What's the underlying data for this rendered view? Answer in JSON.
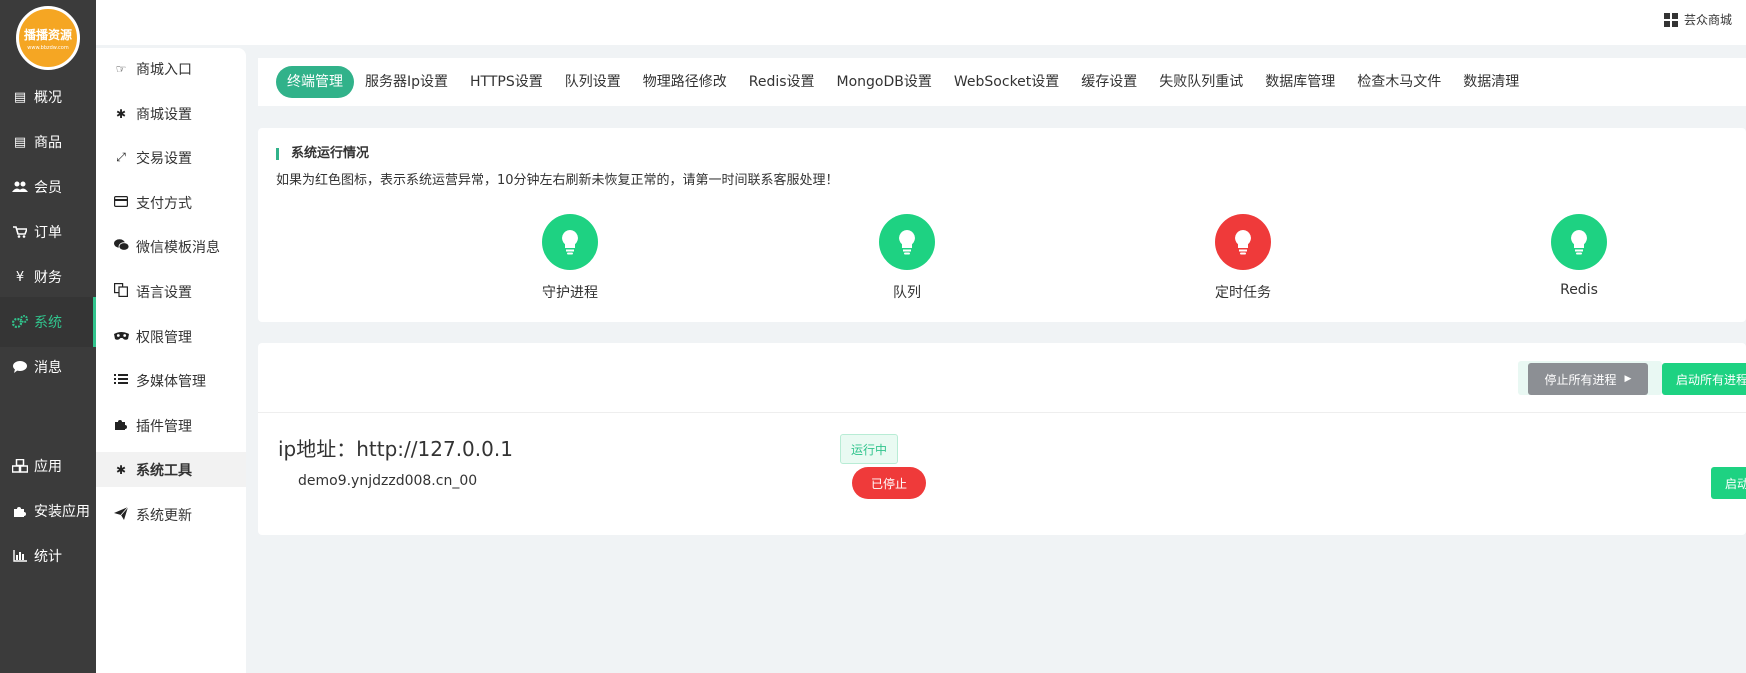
{
  "brand": {
    "logo_text": "播播资源",
    "logo_sub": "www.bbzdw.com"
  },
  "main_nav": [
    {
      "label": "概况",
      "icon": "dashboard-icon"
    },
    {
      "label": "商品",
      "icon": "product-icon"
    },
    {
      "label": "会员",
      "icon": "users-icon"
    },
    {
      "label": "订单",
      "icon": "cart-icon"
    },
    {
      "label": "财务",
      "icon": "yen-icon"
    },
    {
      "label": "系统",
      "icon": "gears-icon",
      "active": true
    },
    {
      "label": "消息",
      "icon": "chat-icon"
    },
    {
      "label": "应用",
      "icon": "cubes-icon"
    },
    {
      "label": "安装应用",
      "icon": "puzzle-icon"
    },
    {
      "label": "统计",
      "icon": "bar-chart-icon"
    }
  ],
  "sub_nav": [
    {
      "label": "商城入口",
      "icon": "hand-pointer-icon"
    },
    {
      "label": "商城设置",
      "icon": "gear-icon"
    },
    {
      "label": "交易设置",
      "icon": "compress-icon"
    },
    {
      "label": "支付方式",
      "icon": "credit-card-icon"
    },
    {
      "label": "微信模板消息",
      "icon": "wechat-icon"
    },
    {
      "label": "语言设置",
      "icon": "language-icon"
    },
    {
      "label": "权限管理",
      "icon": "mask-icon"
    },
    {
      "label": "多媒体管理",
      "icon": "list-icon"
    },
    {
      "label": "插件管理",
      "icon": "puzzle-icon"
    },
    {
      "label": "系统工具",
      "icon": "gear-icon",
      "active": true
    },
    {
      "label": "系统更新",
      "icon": "send-icon"
    }
  ],
  "topbar": {
    "store_label": "芸众商城"
  },
  "tabs": [
    {
      "label": "终端管理",
      "active": true
    },
    {
      "label": "服务器Ip设置"
    },
    {
      "label": "HTTPS设置"
    },
    {
      "label": "队列设置"
    },
    {
      "label": "物理路径修改"
    },
    {
      "label": "Redis设置"
    },
    {
      "label": "MongoDB设置"
    },
    {
      "label": "WebSocket设置"
    },
    {
      "label": "缓存设置"
    },
    {
      "label": "失败队列重试"
    },
    {
      "label": "数据库管理"
    },
    {
      "label": "检查木马文件"
    },
    {
      "label": "数据清理"
    }
  ],
  "status": {
    "title": "系统运行情况",
    "description": "如果为红色图标，表示系统运营异常，10分钟左右刷新未恢复正常的，请第一时间联系客服处理！",
    "items": [
      {
        "label": "守护进程",
        "state": "ok"
      },
      {
        "label": "队列",
        "state": "ok"
      },
      {
        "label": "定时任务",
        "state": "error"
      },
      {
        "label": "Redis",
        "state": "ok"
      }
    ],
    "colors": {
      "ok": "#1ed282",
      "error": "#ef3a3a"
    }
  },
  "process": {
    "stop_all_label": "停止所有进程",
    "start_all_label": "启动所有进程",
    "ip_label": "ip地址：http://127.0.0.1",
    "domain": "demo9.ynjdzzd008.cn_00",
    "running_badge": "运行中",
    "stopped_badge": "已停止",
    "start_label": "启动"
  },
  "accent": "#31b28a"
}
